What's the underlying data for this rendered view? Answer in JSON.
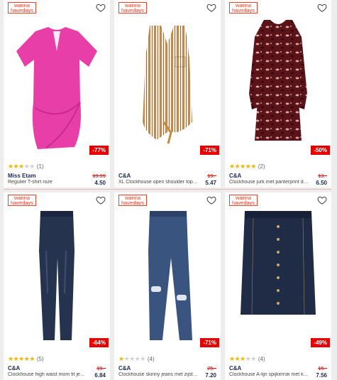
{
  "products": [
    {
      "badge_line1": "wanna",
      "badge_line2": "havedays",
      "discount": "-77%",
      "rating": 3,
      "reviews": "(1)",
      "brand": "Miss Etam",
      "description": "Regulier T-shirt roze",
      "old_price": "19.99",
      "price": "4.50"
    },
    {
      "badge_line1": "wanna",
      "badge_line2": "havedays",
      "discount": "-71%",
      "rating": 0,
      "reviews": "",
      "brand": "C&A",
      "description": "XL Clockhouse open shoulder top ecru",
      "old_price": "19.-",
      "price": "5.47"
    },
    {
      "badge_line1": "wanna",
      "badge_line2": "havedays",
      "discount": "-50%",
      "rating": 4.5,
      "reviews": "(2)",
      "brand": "C&A",
      "description": "Clockhouse jurk met panterprint donke...",
      "old_price": "13.-",
      "price": "6.50"
    },
    {
      "badge_line1": "wanna",
      "badge_line2": "havedays",
      "discount": "-64%",
      "rating": 4.5,
      "reviews": "(5)",
      "brand": "C&A",
      "description": "Clockhouse high waist mom fit jeans d...",
      "old_price": "19.-",
      "price": "6.84"
    },
    {
      "badge_line1": "wanna",
      "badge_line2": "havedays",
      "discount": "-71%",
      "rating": 1.5,
      "reviews": "(4)",
      "brand": "C&A",
      "description": "Clockhouse skinny jeans met zijstreep e...",
      "old_price": "25.-",
      "price": "7.20"
    },
    {
      "badge_line1": "wanna",
      "badge_line2": "havedays",
      "discount": "-49%",
      "rating": 3,
      "reviews": "(4)",
      "brand": "C&A",
      "description": "Clockhouse A-lijn spijkerrok met knope...",
      "old_price": "15.-",
      "price": "7.56"
    }
  ],
  "colors": {
    "badge": "#e8412c",
    "discount": "#e60000",
    "brand": "#1c2a55",
    "star": "#f5b400"
  }
}
